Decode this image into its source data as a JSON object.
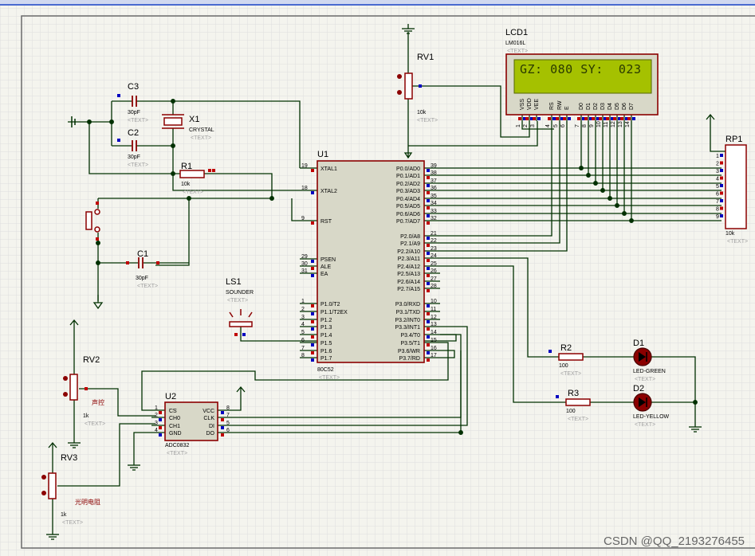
{
  "components": {
    "lcd": {
      "ref": "LCD1",
      "part": "LM016L",
      "text": "<TEXT>",
      "display_line1": "GZ: 080 SY:  023",
      "pins": [
        "VSS",
        "VDD",
        "VEE",
        "RS",
        "RW",
        "E",
        "D0",
        "D1",
        "D2",
        "D3",
        "D4",
        "D5",
        "D6",
        "D7"
      ],
      "pin_numbers": [
        "1",
        "2",
        "3",
        "4",
        "5",
        "6",
        "7",
        "8",
        "9",
        "10",
        "11",
        "12",
        "13",
        "14"
      ]
    },
    "rv1": {
      "ref": "RV1",
      "value": "10k",
      "text": "<TEXT>"
    },
    "rp1": {
      "ref": "RP1",
      "value": "10k",
      "text": "<TEXT>",
      "pin_numbers": [
        "1",
        "2",
        "3",
        "4",
        "5",
        "6",
        "7",
        "8",
        "9"
      ]
    },
    "c3": {
      "ref": "C3",
      "value": "30pF",
      "text": "<TEXT>"
    },
    "c2": {
      "ref": "C2",
      "value": "30pF",
      "text": "<TEXT>"
    },
    "x1": {
      "ref": "X1",
      "part": "CRYSTAL",
      "text": "<TEXT>"
    },
    "r1": {
      "ref": "R1",
      "value": "10k",
      "text": "<TEXT>"
    },
    "c1": {
      "ref": "C1",
      "value": "30pF",
      "text": "<TEXT>"
    },
    "ls1": {
      "ref": "LS1",
      "part": "SOUNDER",
      "text": "<TEXT>"
    },
    "u1": {
      "ref": "U1",
      "part": "80C52",
      "text": "<TEXT>",
      "left_pins": [
        {
          "num": "19",
          "name": "XTAL1"
        },
        {
          "num": "18",
          "name": "XTAL2"
        },
        {
          "num": "9",
          "name": "RST"
        },
        {
          "num": "29",
          "name": "PSEN"
        },
        {
          "num": "30",
          "name": "ALE"
        },
        {
          "num": "31",
          "name": "EA"
        },
        {
          "num": "1",
          "name": "P1.0/T2"
        },
        {
          "num": "2",
          "name": "P1.1/T2EX"
        },
        {
          "num": "3",
          "name": "P1.2"
        },
        {
          "num": "4",
          "name": "P1.3"
        },
        {
          "num": "5",
          "name": "P1.4"
        },
        {
          "num": "6",
          "name": "P1.5"
        },
        {
          "num": "7",
          "name": "P1.6"
        },
        {
          "num": "8",
          "name": "P1.7"
        }
      ],
      "right_pins": [
        {
          "num": "39",
          "name": "P0.0/AD0"
        },
        {
          "num": "38",
          "name": "P0.1/AD1"
        },
        {
          "num": "37",
          "name": "P0.2/AD2"
        },
        {
          "num": "36",
          "name": "P0.3/AD3"
        },
        {
          "num": "35",
          "name": "P0.4/AD4"
        },
        {
          "num": "34",
          "name": "P0.5/AD5"
        },
        {
          "num": "33",
          "name": "P0.6/AD6"
        },
        {
          "num": "32",
          "name": "P0.7/AD7"
        },
        {
          "num": "21",
          "name": "P2.0/A8"
        },
        {
          "num": "22",
          "name": "P2.1/A9"
        },
        {
          "num": "23",
          "name": "P2.2/A10"
        },
        {
          "num": "24",
          "name": "P2.3/A11"
        },
        {
          "num": "25",
          "name": "P2.4/A12"
        },
        {
          "num": "26",
          "name": "P2.5/A13"
        },
        {
          "num": "27",
          "name": "P2.6/A14"
        },
        {
          "num": "28",
          "name": "P2.7/A15"
        },
        {
          "num": "10",
          "name": "P3.0/RXD"
        },
        {
          "num": "11",
          "name": "P3.1/TXD"
        },
        {
          "num": "12",
          "name": "P3.2/INT0"
        },
        {
          "num": "13",
          "name": "P3.3/INT1"
        },
        {
          "num": "14",
          "name": "P3.4/T0"
        },
        {
          "num": "15",
          "name": "P3.5/T1"
        },
        {
          "num": "16",
          "name": "P3.6/WR"
        },
        {
          "num": "17",
          "name": "P3.7/RD"
        }
      ]
    },
    "rv2": {
      "ref": "RV2",
      "value": "1k",
      "text": "<TEXT>",
      "label_cn": "声控"
    },
    "u2": {
      "ref": "U2",
      "part": "ADC0832",
      "text": "<TEXT>",
      "left_pins": [
        {
          "num": "1",
          "name": "CS"
        },
        {
          "num": "2",
          "name": "CH0"
        },
        {
          "num": "3",
          "name": "CH1"
        },
        {
          "num": "4",
          "name": "GND"
        }
      ],
      "right_pins": [
        {
          "num": "8",
          "name": "VCC"
        },
        {
          "num": "7",
          "name": "CLK"
        },
        {
          "num": "5",
          "name": "DI"
        },
        {
          "num": "6",
          "name": "DO"
        }
      ]
    },
    "rv3": {
      "ref": "RV3",
      "value": "1k",
      "text": "<TEXT>",
      "label_cn": "光明电阻"
    },
    "r2": {
      "ref": "R2",
      "value": "100",
      "text": "<TEXT>"
    },
    "r3": {
      "ref": "R3",
      "value": "100",
      "text": "<TEXT>"
    },
    "d1": {
      "ref": "D1",
      "part": "LED-GREEN",
      "text": "<TEXT>"
    },
    "d2": {
      "ref": "D2",
      "part": "LED-YELLOW",
      "text": "<TEXT>"
    }
  },
  "watermark": "CSDN @QQ_2193276455",
  "colors": {
    "wire": "#003000",
    "part": "#8b0000",
    "ref": "#000000",
    "text_gray": "#a0a0a0",
    "pin_red": "#c00000",
    "pin_blue": "#0000c0",
    "lcd_screen": "#a5c100",
    "lcd_text": "#2a3a00",
    "grid": "#d8d8d8",
    "sheet_border": "#7a7a7a"
  }
}
